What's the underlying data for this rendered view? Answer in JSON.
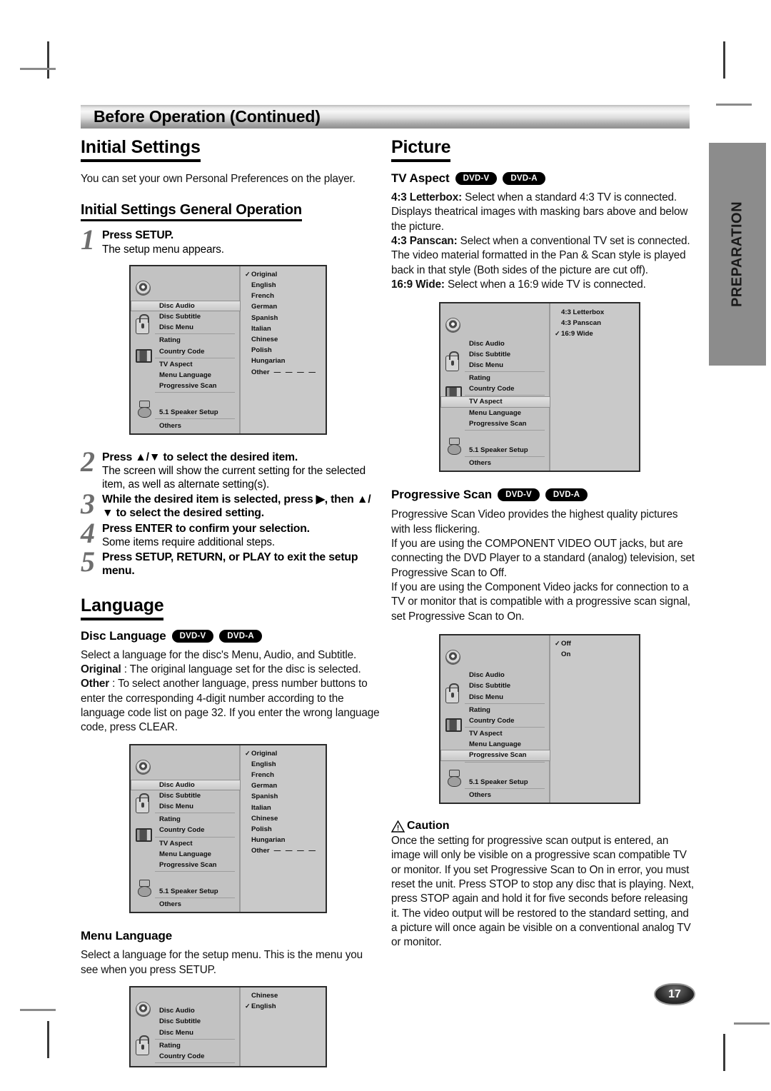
{
  "page": {
    "banner_title": "Before Operation (Continued)",
    "side_tab": "PREPARATION",
    "page_number": "17"
  },
  "left_column": {
    "initial_settings_heading": "Initial Settings",
    "initial_settings_intro": "You can set your own Personal Preferences on the player.",
    "general_operation_heading": "Initial Settings General Operation",
    "steps": [
      {
        "num": "1",
        "head": "Press SETUP.",
        "sub": "The setup menu appears."
      },
      {
        "num": "2",
        "head": "Press ▲/▼ to select the desired item.",
        "sub": "The screen will show the current setting for the selected item, as well as alternate setting(s)."
      },
      {
        "num": "3",
        "head": "While the desired item is selected, press ▶, then ▲/▼ to select the desired setting.",
        "sub": ""
      },
      {
        "num": "4",
        "head": "Press ENTER to confirm your selection.",
        "sub": "Some items require additional steps."
      },
      {
        "num": "5",
        "head": "Press SETUP, RETURN, or PLAY to exit the setup menu.",
        "sub": ""
      }
    ],
    "language_heading": "Language",
    "disc_language_title": "Disc Language",
    "disc_language_badges": [
      "DVD-V",
      "DVD-A"
    ],
    "disc_language_body_1": "Select a language for the disc's Menu, Audio, and Subtitle.",
    "disc_language_original_label": "Original",
    "disc_language_original_text": " : The original language set for the disc is selected.",
    "disc_language_other_label": "Other",
    "disc_language_other_text": " : To select another language, press number buttons to enter the corresponding 4-digit number according to the language code list on page 32. If you enter the wrong language code, press CLEAR.",
    "menu_language_title": "Menu Language",
    "menu_language_body": "Select a language for the setup menu. This is the menu you see when you press SETUP."
  },
  "right_column": {
    "picture_heading": "Picture",
    "tv_aspect_title": "TV Aspect",
    "tv_aspect_badges": [
      "DVD-V",
      "DVD-A"
    ],
    "tv_aspect_letterbox_label": "4:3 Letterbox:",
    "tv_aspect_letterbox_text": " Select when a standard 4:3 TV is connected. Displays theatrical images with masking bars above and below the picture.",
    "tv_aspect_panscan_label": "4:3 Panscan:",
    "tv_aspect_panscan_text": " Select when a conventional TV set is connected. The video material formatted in the Pan & Scan style is played back in that style (Both sides of the picture are cut off).",
    "tv_aspect_wide_label": "16:9 Wide:",
    "tv_aspect_wide_text": " Select when a 16:9 wide TV is connected.",
    "progressive_scan_title": "Progressive Scan",
    "progressive_scan_badges": [
      "DVD-V",
      "DVD-A"
    ],
    "progressive_scan_body": "Progressive Scan Video provides the highest quality pictures with less flickering.\nIf you are using the COMPONENT VIDEO OUT jacks, but are connecting the DVD Player to a standard (analog) television, set Progressive Scan to Off.\nIf you are using the Component Video jacks for connection to a TV or monitor that is compatible with a progressive scan signal, set Progressive Scan to On.",
    "caution_title": "Caution",
    "caution_body": "Once the setting for progressive scan output is entered, an image will only be visible on a progressive scan compatible TV or monitor. If you set Progressive Scan to On in error, you must reset the unit. Press STOP to stop any disc that is playing. Next, press STOP again and hold it for five seconds before releasing it. The video output will be restored to the standard setting, and a picture will once again be visible on a conventional analog TV or monitor."
  },
  "osd_menus": {
    "menu_items": [
      "Disc Audio",
      "Disc Subtitle",
      "Disc Menu",
      "Rating",
      "Country Code",
      "TV Aspect",
      "Menu Language",
      "Progressive Scan",
      "5.1 Speaker Setup",
      "Others"
    ],
    "disc_audio_menu": {
      "selected_item": "Disc Audio",
      "options": [
        "Original",
        "English",
        "French",
        "German",
        "Spanish",
        "Italian",
        "Chinese",
        "Polish",
        "Hungarian",
        "Other"
      ],
      "checked_option": "Original",
      "other_dashes": "— — — —"
    },
    "tv_aspect_menu": {
      "selected_item": "TV Aspect",
      "options": [
        "4:3   Letterbox",
        "4:3   Panscan",
        "16:9 Wide"
      ],
      "checked_option": "16:9 Wide"
    },
    "progressive_scan_menu": {
      "selected_item": "Progressive Scan",
      "options": [
        "Off",
        "On"
      ],
      "checked_option": "Off"
    },
    "menu_language_menu": {
      "selected_item": "Menu Language",
      "options": [
        "Chinese",
        "English"
      ],
      "checked_option": "English"
    },
    "check_glyph": "✓"
  }
}
